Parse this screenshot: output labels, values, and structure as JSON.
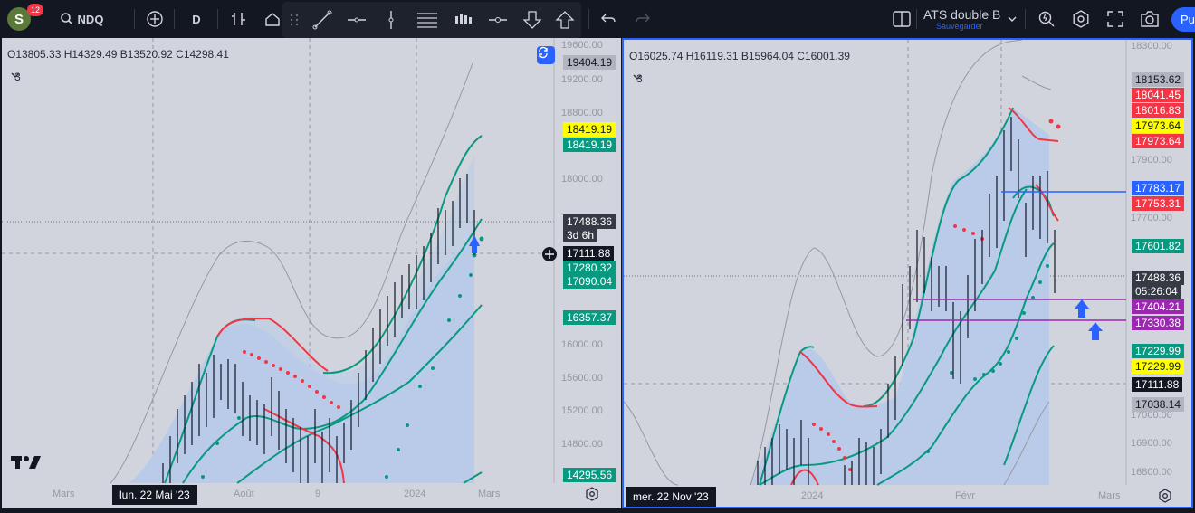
{
  "toolbar": {
    "avatar_letter": "S",
    "notifications": "12",
    "symbol": "NDQ",
    "interval": "D",
    "layout_name": "ATS double B",
    "save_status": "Sauvegarder",
    "publish_label": "Pu"
  },
  "left_pane": {
    "ohlc": "O13805.33 H14329.49 B13520.92 C14298.41",
    "indicator_count": "3",
    "scale": [
      "19600.00",
      "19200.00",
      "18800.00",
      "18000.00",
      "16000.00",
      "15600.00",
      "15200.00",
      "14800.00"
    ],
    "price_labels": [
      {
        "text": "19404.19",
        "bg": "#b2b5be",
        "fg": "#131722"
      },
      {
        "text": "18419.19",
        "bg": "#ffff00",
        "fg": "#131722"
      },
      {
        "text": "18419.19",
        "bg": "#089981",
        "fg": "#ffffff"
      },
      {
        "text": "17488.36",
        "bg": "#363a45",
        "fg": "#ffffff"
      },
      {
        "text": "3d 6h",
        "bg": "#363a45",
        "fg": "#ffffff"
      },
      {
        "text": "17111.88",
        "bg": "#131722",
        "fg": "#ffffff"
      },
      {
        "text": "17280.32",
        "bg": "#089981",
        "fg": "#ffffff"
      },
      {
        "text": "17090.04",
        "bg": "#089981",
        "fg": "#ffffff"
      },
      {
        "text": "16357.37",
        "bg": "#089981",
        "fg": "#ffffff"
      },
      {
        "text": "14295.56",
        "bg": "#089981",
        "fg": "#ffffff"
      }
    ],
    "x_labels": [
      "Mars",
      "Août",
      "9",
      "2024",
      "Mars"
    ],
    "crosshair_date": "lun. 22 Mai '23"
  },
  "right_pane": {
    "ohlc": "O16025.74 H16119.31 B15964.04 C16001.39",
    "indicator_count": "3",
    "scale": [
      "18300.00",
      "17900.00",
      "17700.00",
      "17000.00",
      "16900.00",
      "16800.00"
    ],
    "price_labels": [
      {
        "text": "18153.62",
        "bg": "#b2b5be",
        "fg": "#131722"
      },
      {
        "text": "18041.45",
        "bg": "#f23645",
        "fg": "#ffffff"
      },
      {
        "text": "18016.83",
        "bg": "#f23645",
        "fg": "#ffffff"
      },
      {
        "text": "17973.64",
        "bg": "#ffff00",
        "fg": "#131722"
      },
      {
        "text": "17973.64",
        "bg": "#f23645",
        "fg": "#ffffff"
      },
      {
        "text": "17783.17",
        "bg": "#2962ff",
        "fg": "#ffffff"
      },
      {
        "text": "17753.31",
        "bg": "#f23645",
        "fg": "#ffffff"
      },
      {
        "text": "17601.82",
        "bg": "#089981",
        "fg": "#ffffff"
      },
      {
        "text": "17488.36",
        "bg": "#363a45",
        "fg": "#ffffff"
      },
      {
        "text": "05:26:04",
        "bg": "#363a45",
        "fg": "#ffffff"
      },
      {
        "text": "17404.21",
        "bg": "#9c27b0",
        "fg": "#ffffff"
      },
      {
        "text": "17330.38",
        "bg": "#9c27b0",
        "fg": "#ffffff"
      },
      {
        "text": "17229.99",
        "bg": "#089981",
        "fg": "#ffffff"
      },
      {
        "text": "17229.99",
        "bg": "#ffff00",
        "fg": "#131722"
      },
      {
        "text": "17111.88",
        "bg": "#131722",
        "fg": "#ffffff"
      },
      {
        "text": "17038.14",
        "bg": "#b2b5be",
        "fg": "#131722"
      }
    ],
    "x_labels": [
      "2024",
      "Févr",
      "Mars"
    ],
    "crosshair_date": "mer. 22 Nov '23"
  },
  "colors": {
    "accent": "#2962ff",
    "band_green": "#089981",
    "band_red": "#f23645",
    "fill": "#b9cbe8",
    "purple": "#9c27b0"
  },
  "icons": {
    "left": [
      "search-icon",
      "add-symbol-icon",
      "indicators-icon",
      "templates-icon"
    ],
    "drawing": [
      "drag-handle-icon",
      "trend-line-icon",
      "horizontal-line-icon",
      "vertical-line-icon",
      "channel-icon",
      "long-position-icon",
      "price-range-icon",
      "arrow-down-icon",
      "arrow-up-icon"
    ],
    "right": [
      "undo-icon",
      "redo-icon",
      "layout-icon",
      "chevron-down-icon",
      "quick-search-icon",
      "settings-icon",
      "fullscreen-icon",
      "snapshot-icon"
    ]
  }
}
